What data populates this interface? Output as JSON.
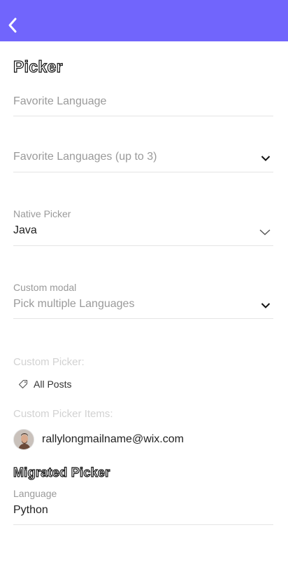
{
  "header": {
    "back_icon": "chevron-left-icon",
    "color": "#7165fc"
  },
  "picker_section": {
    "title": "Picker",
    "favorite_language": {
      "placeholder": "Favorite Language"
    },
    "favorite_languages": {
      "placeholder": "Favorite Languages (up to 3)",
      "icon": "chevron-down-icon"
    },
    "native_picker": {
      "label": "Native Picker",
      "value": "Java",
      "icon": "chevron-down-icon"
    },
    "custom_modal": {
      "label": "Custom modal",
      "placeholder": "Pick multiple Languages",
      "icon": "chevron-down-icon"
    },
    "custom_picker": {
      "label": "Custom Picker:",
      "tag_icon": "tag-icon",
      "tag_label": "All Posts"
    },
    "custom_picker_items": {
      "label": "Custom Picker Items:",
      "email": "rallylongmailname@wix.com"
    }
  },
  "migrated_section": {
    "title": "Migrated Picker",
    "language": {
      "label": "Language",
      "value": "Python"
    }
  }
}
